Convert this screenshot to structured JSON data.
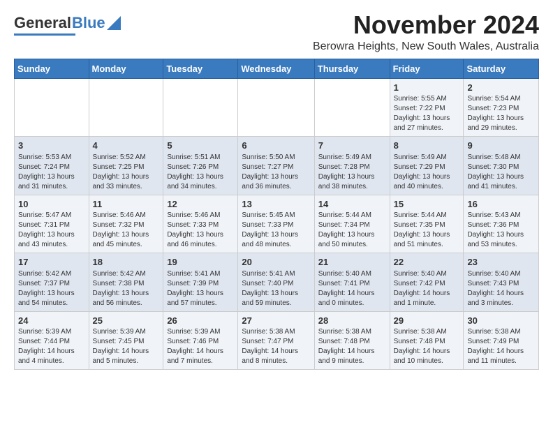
{
  "logo": {
    "general": "General",
    "blue": "Blue"
  },
  "header": {
    "month": "November 2024",
    "location": "Berowra Heights, New South Wales, Australia"
  },
  "weekdays": [
    "Sunday",
    "Monday",
    "Tuesday",
    "Wednesday",
    "Thursday",
    "Friday",
    "Saturday"
  ],
  "weeks": [
    [
      {
        "day": "",
        "info": ""
      },
      {
        "day": "",
        "info": ""
      },
      {
        "day": "",
        "info": ""
      },
      {
        "day": "",
        "info": ""
      },
      {
        "day": "",
        "info": ""
      },
      {
        "day": "1",
        "info": "Sunrise: 5:55 AM\nSunset: 7:22 PM\nDaylight: 13 hours\nand 27 minutes."
      },
      {
        "day": "2",
        "info": "Sunrise: 5:54 AM\nSunset: 7:23 PM\nDaylight: 13 hours\nand 29 minutes."
      }
    ],
    [
      {
        "day": "3",
        "info": "Sunrise: 5:53 AM\nSunset: 7:24 PM\nDaylight: 13 hours\nand 31 minutes."
      },
      {
        "day": "4",
        "info": "Sunrise: 5:52 AM\nSunset: 7:25 PM\nDaylight: 13 hours\nand 33 minutes."
      },
      {
        "day": "5",
        "info": "Sunrise: 5:51 AM\nSunset: 7:26 PM\nDaylight: 13 hours\nand 34 minutes."
      },
      {
        "day": "6",
        "info": "Sunrise: 5:50 AM\nSunset: 7:27 PM\nDaylight: 13 hours\nand 36 minutes."
      },
      {
        "day": "7",
        "info": "Sunrise: 5:49 AM\nSunset: 7:28 PM\nDaylight: 13 hours\nand 38 minutes."
      },
      {
        "day": "8",
        "info": "Sunrise: 5:49 AM\nSunset: 7:29 PM\nDaylight: 13 hours\nand 40 minutes."
      },
      {
        "day": "9",
        "info": "Sunrise: 5:48 AM\nSunset: 7:30 PM\nDaylight: 13 hours\nand 41 minutes."
      }
    ],
    [
      {
        "day": "10",
        "info": "Sunrise: 5:47 AM\nSunset: 7:31 PM\nDaylight: 13 hours\nand 43 minutes."
      },
      {
        "day": "11",
        "info": "Sunrise: 5:46 AM\nSunset: 7:32 PM\nDaylight: 13 hours\nand 45 minutes."
      },
      {
        "day": "12",
        "info": "Sunrise: 5:46 AM\nSunset: 7:33 PM\nDaylight: 13 hours\nand 46 minutes."
      },
      {
        "day": "13",
        "info": "Sunrise: 5:45 AM\nSunset: 7:33 PM\nDaylight: 13 hours\nand 48 minutes."
      },
      {
        "day": "14",
        "info": "Sunrise: 5:44 AM\nSunset: 7:34 PM\nDaylight: 13 hours\nand 50 minutes."
      },
      {
        "day": "15",
        "info": "Sunrise: 5:44 AM\nSunset: 7:35 PM\nDaylight: 13 hours\nand 51 minutes."
      },
      {
        "day": "16",
        "info": "Sunrise: 5:43 AM\nSunset: 7:36 PM\nDaylight: 13 hours\nand 53 minutes."
      }
    ],
    [
      {
        "day": "17",
        "info": "Sunrise: 5:42 AM\nSunset: 7:37 PM\nDaylight: 13 hours\nand 54 minutes."
      },
      {
        "day": "18",
        "info": "Sunrise: 5:42 AM\nSunset: 7:38 PM\nDaylight: 13 hours\nand 56 minutes."
      },
      {
        "day": "19",
        "info": "Sunrise: 5:41 AM\nSunset: 7:39 PM\nDaylight: 13 hours\nand 57 minutes."
      },
      {
        "day": "20",
        "info": "Sunrise: 5:41 AM\nSunset: 7:40 PM\nDaylight: 13 hours\nand 59 minutes."
      },
      {
        "day": "21",
        "info": "Sunrise: 5:40 AM\nSunset: 7:41 PM\nDaylight: 14 hours\nand 0 minutes."
      },
      {
        "day": "22",
        "info": "Sunrise: 5:40 AM\nSunset: 7:42 PM\nDaylight: 14 hours\nand 1 minute."
      },
      {
        "day": "23",
        "info": "Sunrise: 5:40 AM\nSunset: 7:43 PM\nDaylight: 14 hours\nand 3 minutes."
      }
    ],
    [
      {
        "day": "24",
        "info": "Sunrise: 5:39 AM\nSunset: 7:44 PM\nDaylight: 14 hours\nand 4 minutes."
      },
      {
        "day": "25",
        "info": "Sunrise: 5:39 AM\nSunset: 7:45 PM\nDaylight: 14 hours\nand 5 minutes."
      },
      {
        "day": "26",
        "info": "Sunrise: 5:39 AM\nSunset: 7:46 PM\nDaylight: 14 hours\nand 7 minutes."
      },
      {
        "day": "27",
        "info": "Sunrise: 5:38 AM\nSunset: 7:47 PM\nDaylight: 14 hours\nand 8 minutes."
      },
      {
        "day": "28",
        "info": "Sunrise: 5:38 AM\nSunset: 7:48 PM\nDaylight: 14 hours\nand 9 minutes."
      },
      {
        "day": "29",
        "info": "Sunrise: 5:38 AM\nSunset: 7:48 PM\nDaylight: 14 hours\nand 10 minutes."
      },
      {
        "day": "30",
        "info": "Sunrise: 5:38 AM\nSunset: 7:49 PM\nDaylight: 14 hours\nand 11 minutes."
      }
    ]
  ]
}
